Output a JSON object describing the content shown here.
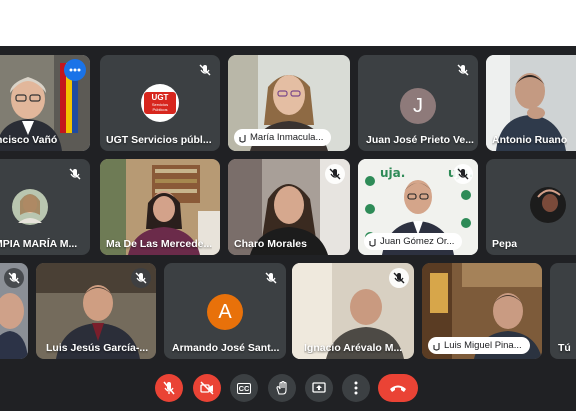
{
  "participants": [
    {
      "name": "Francisco Vañó",
      "display": "ncisco Vañó"
    },
    {
      "name": "UGT Servicios públ..."
    },
    {
      "name": "María Inmacula..."
    },
    {
      "name": "Juan José Prieto Ve...",
      "initial": "J"
    },
    {
      "name": "Antonio Ruano"
    },
    {
      "name": "OLIMPIA MARÍA M...",
      "display": "MPIA MARÍA M..."
    },
    {
      "name": "Ma De Las Mercede..."
    },
    {
      "name": "Charo Morales"
    },
    {
      "name": "Juan Gómez Or..."
    },
    {
      "name": "Pepa"
    },
    {
      "name": "Luis Jesús García-..."
    },
    {
      "name": "Armando José Sant...",
      "initial": "A"
    },
    {
      "name": "Ignacio Arévalo M..."
    },
    {
      "name": "Luis Miguel Pina..."
    },
    {
      "name": "Tú"
    }
  ],
  "ugt_logo": {
    "main": "UGT",
    "line1": "Servicios",
    "line2": "Públicos"
  },
  "uja_banner": {
    "text": "uja."
  },
  "colors": {
    "background": "#202124",
    "tile": "#3c4043",
    "active_border": "#8ab4f8",
    "avatar_purple": "#8e7a7a",
    "avatar_orange": "#e8710a",
    "danger": "#ea4335",
    "accent": "#1a73e8"
  },
  "toolbar": {
    "buttons": [
      "microphone-off-icon",
      "camera-off-icon",
      "captions-icon",
      "raise-hand-icon",
      "present-screen-icon",
      "more-options-icon",
      "end-call-icon"
    ],
    "captions_label": "CC"
  }
}
